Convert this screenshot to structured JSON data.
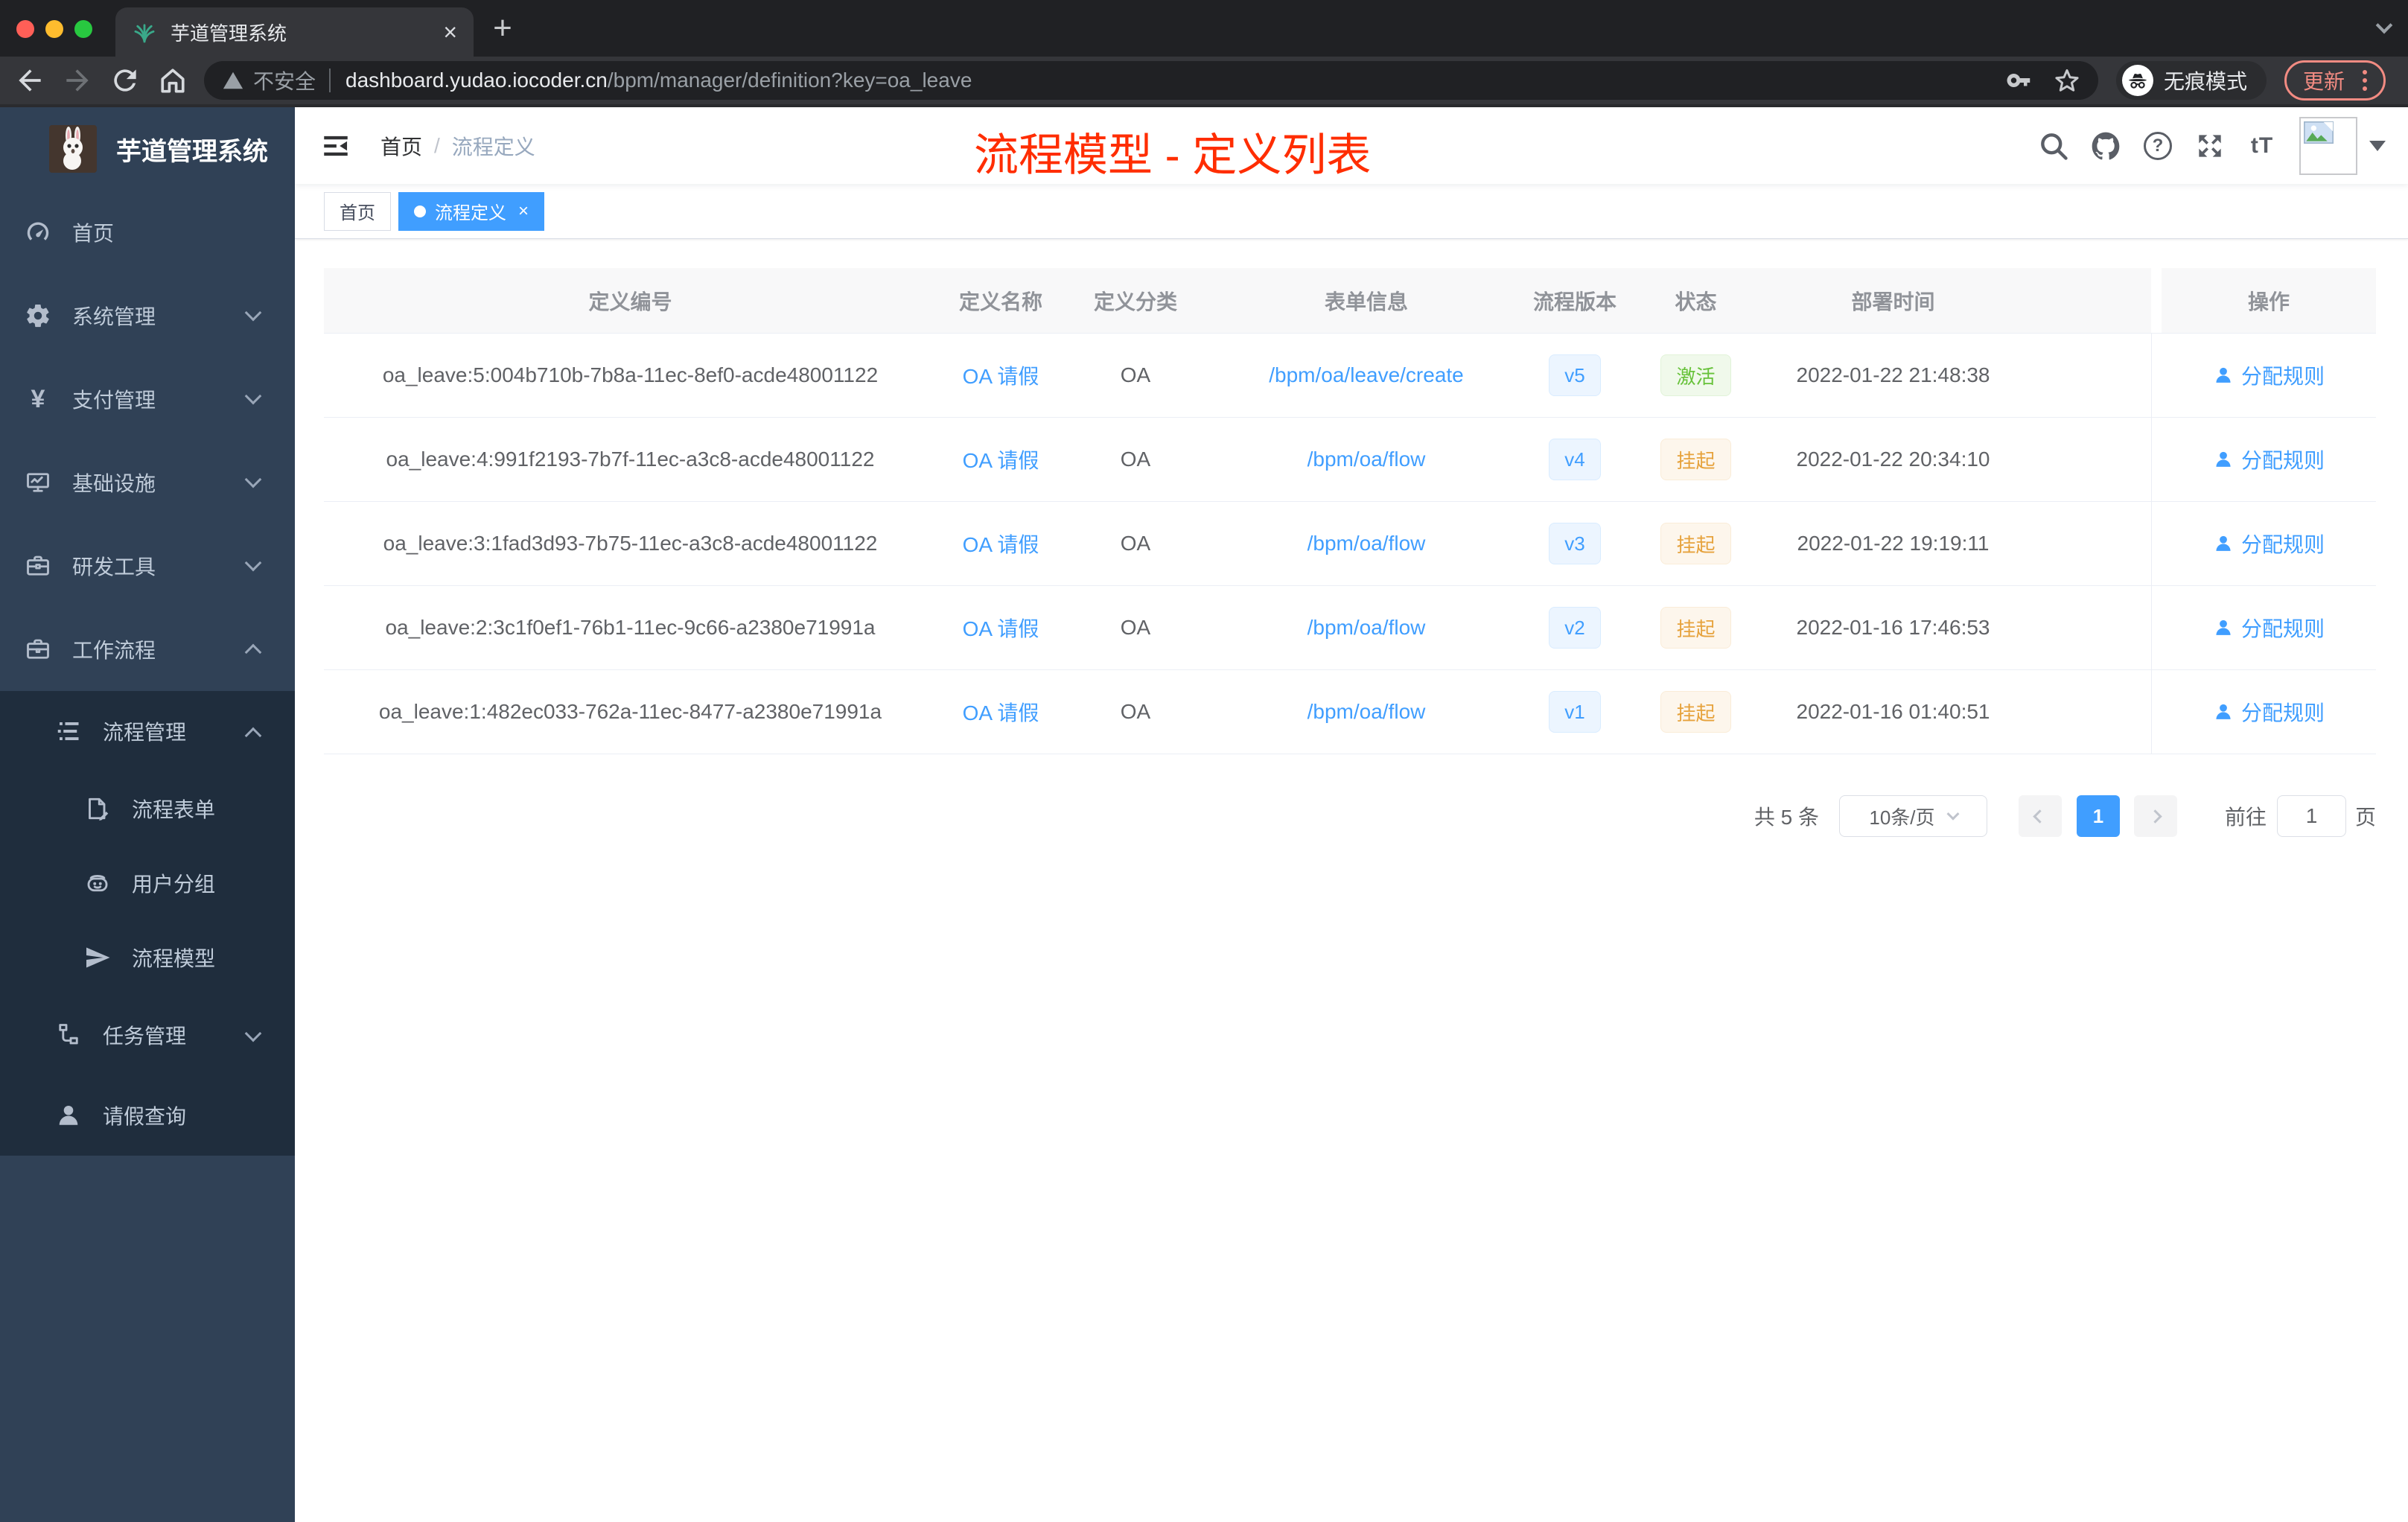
{
  "browser": {
    "tab_title": "芋道管理系统",
    "security_label": "不安全",
    "url_host": "dashboard.yudao.iocoder.cn",
    "url_path": "/bpm/manager/definition?key=oa_leave",
    "incognito_label": "无痕模式",
    "update_label": "更新"
  },
  "sidebar": {
    "app_title": "芋道管理系统",
    "items": [
      {
        "name": "home",
        "label": "首页",
        "icon": "dashboard-icon",
        "level": 1
      },
      {
        "name": "system-management",
        "label": "系统管理",
        "icon": "gear-icon",
        "level": 1,
        "chevron": "down"
      },
      {
        "name": "payment-management",
        "label": "支付管理",
        "icon": "yen-icon",
        "level": 1,
        "chevron": "down"
      },
      {
        "name": "infrastructure",
        "label": "基础设施",
        "icon": "monitor-icon",
        "level": 1,
        "chevron": "down"
      },
      {
        "name": "dev-tools",
        "label": "研发工具",
        "icon": "toolbox-icon",
        "level": 1,
        "chevron": "down"
      },
      {
        "name": "workflow",
        "label": "工作流程",
        "icon": "briefcase-icon",
        "level": 1,
        "chevron": "up"
      },
      {
        "name": "process-management",
        "label": "流程管理",
        "icon": "list-icon",
        "level": 2,
        "chevron": "up",
        "dark": true
      },
      {
        "name": "process-form",
        "label": "流程表单",
        "icon": "form-icon",
        "level": 3,
        "dark": true
      },
      {
        "name": "user-group",
        "label": "用户分组",
        "icon": "group-icon",
        "level": 3,
        "dark": true
      },
      {
        "name": "process-model",
        "label": "流程模型",
        "icon": "plane-icon",
        "level": 3,
        "dark": true
      },
      {
        "name": "task-management",
        "label": "任务管理",
        "icon": "tree-icon",
        "level": 2,
        "chevron": "down",
        "dark": true
      },
      {
        "name": "leave-query",
        "label": "请假查询",
        "icon": "person-icon",
        "level": 2,
        "dark": true
      }
    ]
  },
  "header": {
    "breadcrumb_home": "首页",
    "breadcrumb_separator": "/",
    "breadcrumb_current": "流程定义",
    "annotation": "流程模型 - 定义列表"
  },
  "tags": {
    "home_label": "首页",
    "active_label": "流程定义"
  },
  "table": {
    "columns": [
      "定义编号",
      "定义名称",
      "定义分类",
      "表单信息",
      "流程版本",
      "状态",
      "部署时间",
      "操作"
    ],
    "rows": [
      {
        "id": "oa_leave:5:004b710b-7b8a-11ec-8ef0-acde48001122",
        "name": "OA 请假",
        "category": "OA",
        "form": "/bpm/oa/leave/create",
        "version": "v5",
        "status": "激活",
        "statusType": "success",
        "time": "2022-01-22 21:48:38",
        "action": "分配规则"
      },
      {
        "id": "oa_leave:4:991f2193-7b7f-11ec-a3c8-acde48001122",
        "name": "OA 请假",
        "category": "OA",
        "form": "/bpm/oa/flow",
        "version": "v4",
        "status": "挂起",
        "statusType": "warning",
        "time": "2022-01-22 20:34:10",
        "action": "分配规则"
      },
      {
        "id": "oa_leave:3:1fad3d93-7b75-11ec-a3c8-acde48001122",
        "name": "OA 请假",
        "category": "OA",
        "form": "/bpm/oa/flow",
        "version": "v3",
        "status": "挂起",
        "statusType": "warning",
        "time": "2022-01-22 19:19:11",
        "action": "分配规则"
      },
      {
        "id": "oa_leave:2:3c1f0ef1-76b1-11ec-9c66-a2380e71991a",
        "name": "OA 请假",
        "category": "OA",
        "form": "/bpm/oa/flow",
        "version": "v2",
        "status": "挂起",
        "statusType": "warning",
        "time": "2022-01-16 17:46:53",
        "action": "分配规则"
      },
      {
        "id": "oa_leave:1:482ec033-762a-11ec-8477-a2380e71991a",
        "name": "OA 请假",
        "category": "OA",
        "form": "/bpm/oa/flow",
        "version": "v1",
        "status": "挂起",
        "statusType": "warning",
        "time": "2022-01-16 01:40:51",
        "action": "分配规则"
      }
    ]
  },
  "pagination": {
    "total_label": "共 5 条",
    "page_size": "10条/页",
    "current_page": "1",
    "goto_label": "前往",
    "goto_value": "1",
    "page_unit": "页"
  },
  "colors": {
    "accent": "#409eff",
    "success": "#67c23a",
    "warning": "#e6a23c",
    "annotation_red": "#ff2d00",
    "sidebar_bg": "#304156",
    "sidebar_submenu_bg": "#1f2d3d"
  }
}
